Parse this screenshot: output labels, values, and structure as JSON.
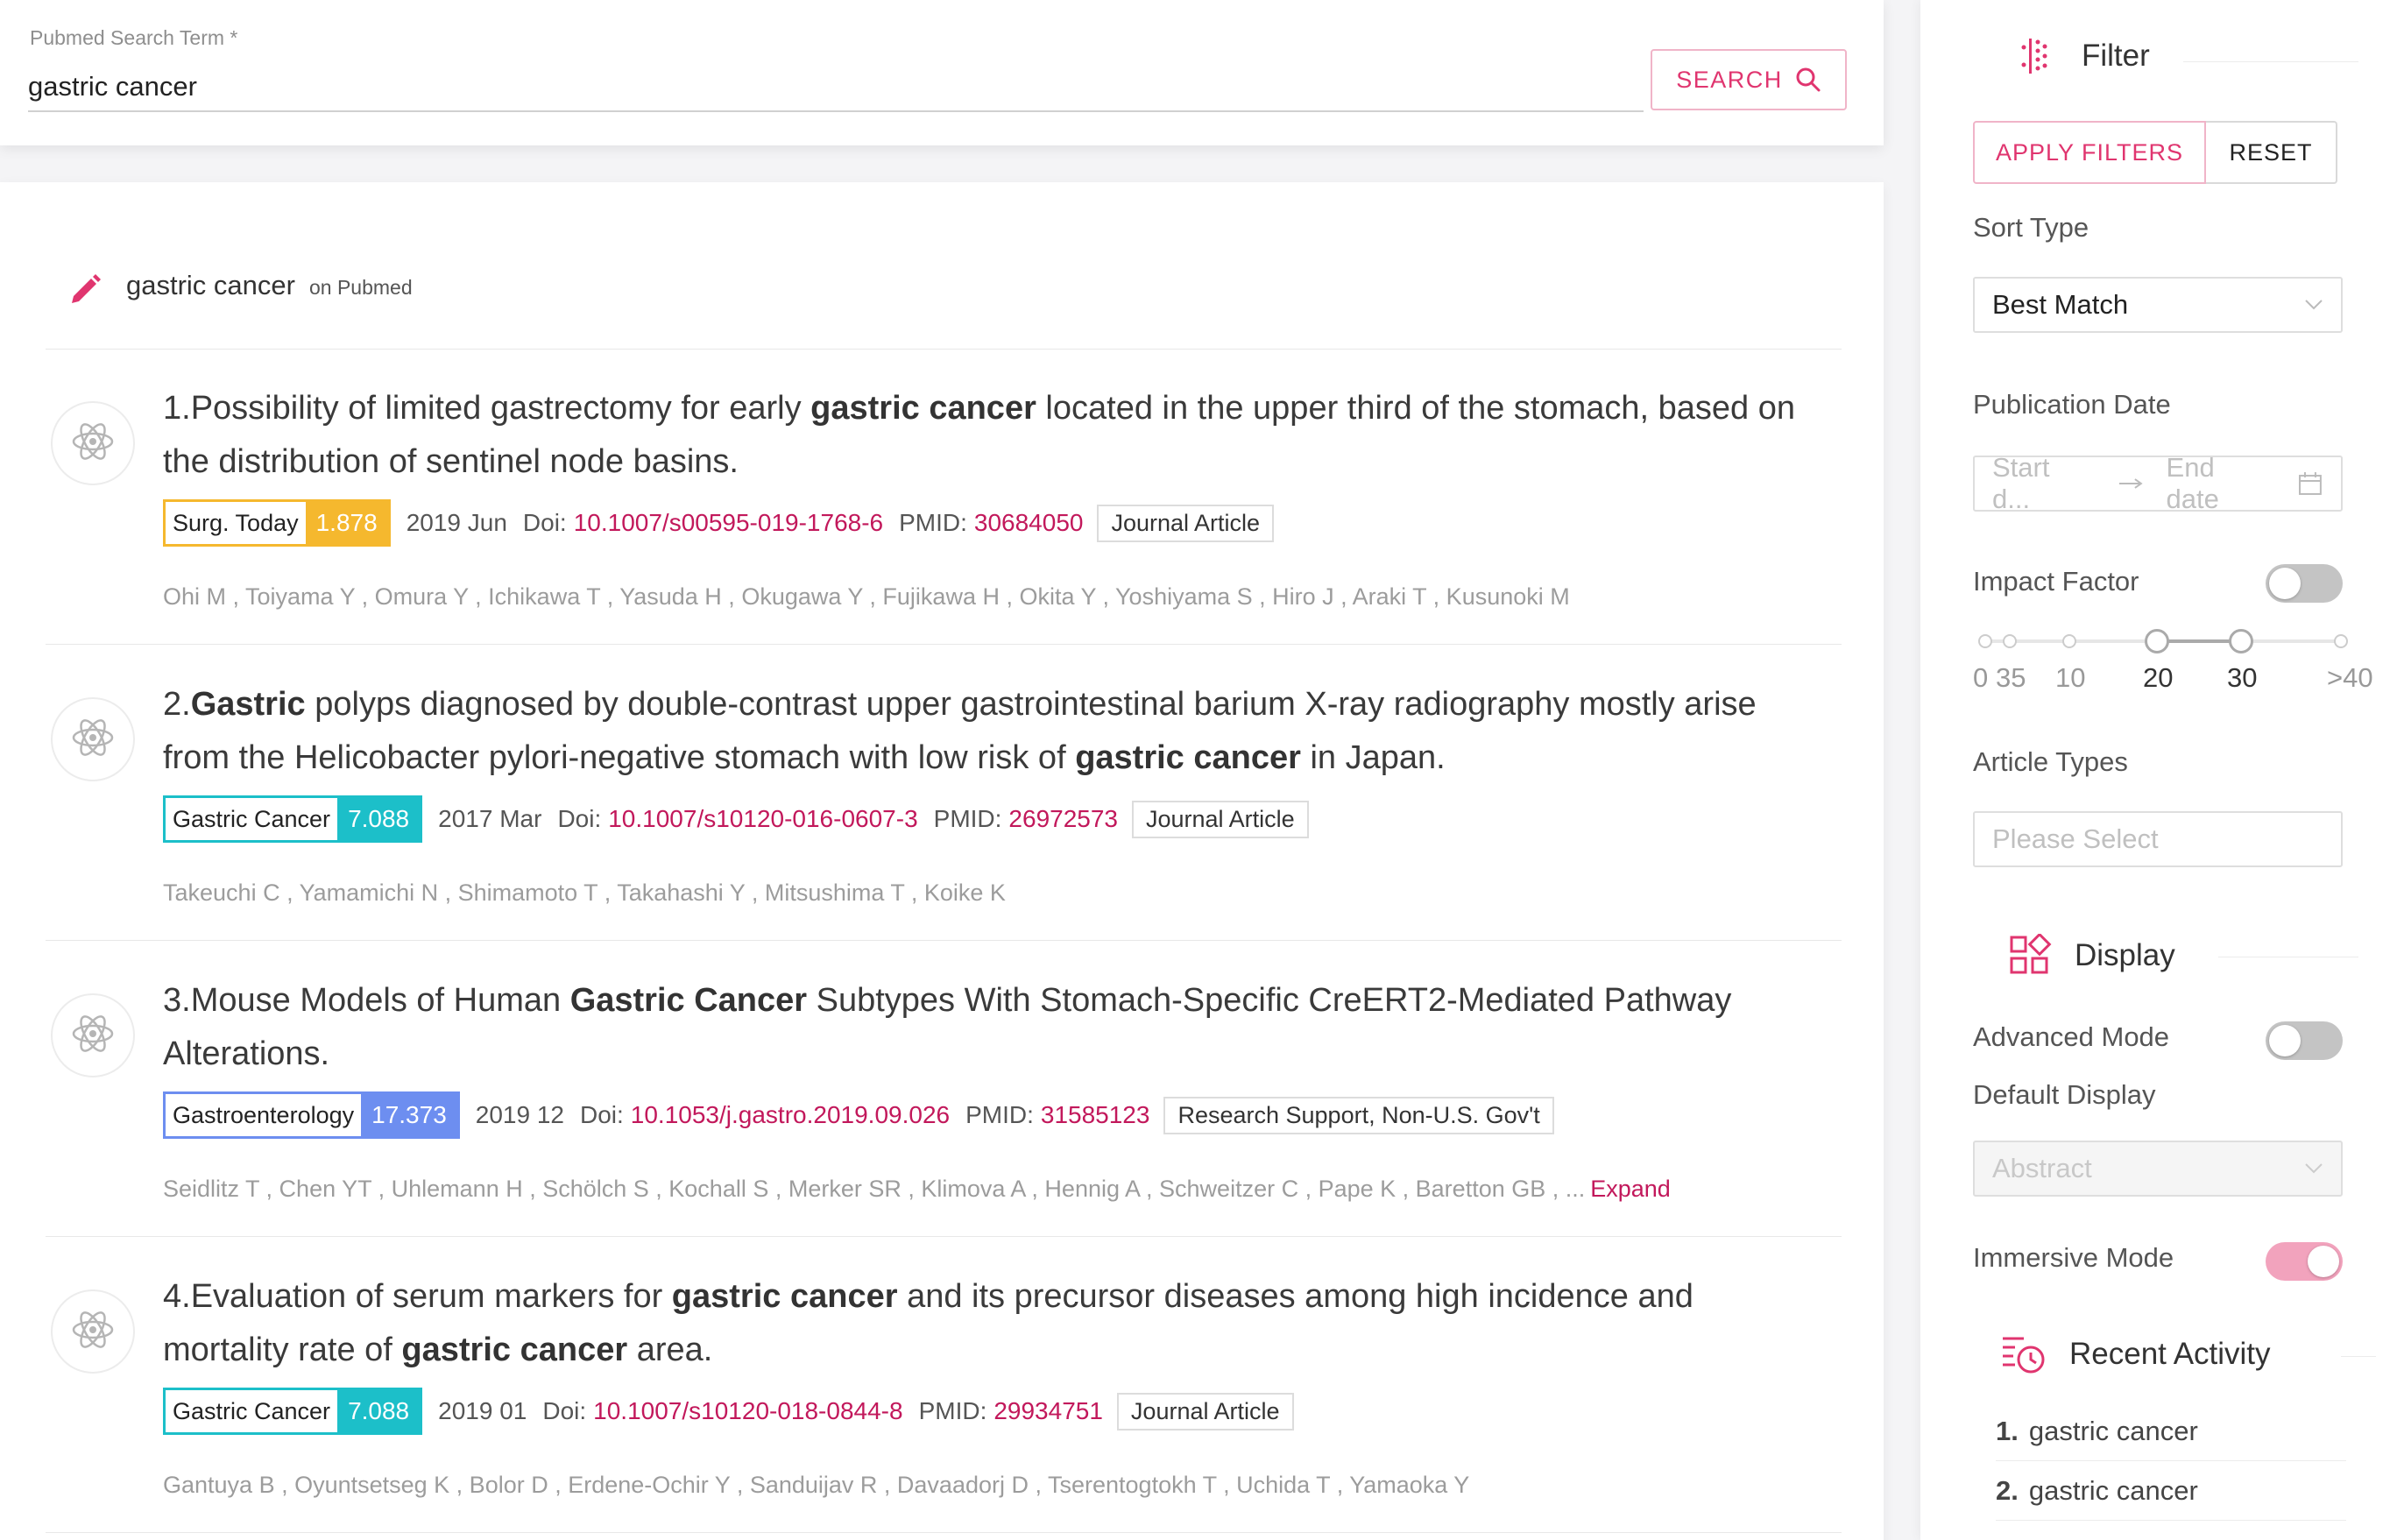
{
  "search": {
    "label": "Pubmed Search Term *",
    "value": "gastric cancer",
    "button_label": "SEARCH"
  },
  "results": {
    "query": "gastric cancer",
    "source": "on Pubmed",
    "articles": [
      {
        "num": "1.",
        "title_parts": [
          {
            "text": "Possibility of limited gastrectomy for early ",
            "bold": false
          },
          {
            "text": "gastric cancer",
            "bold": true
          },
          {
            "text": " located in the upper third of the stomach, based on the distribution of sentinel node basins.",
            "bold": false
          }
        ],
        "journal": "Surg. Today",
        "impact": "1.878",
        "color": "#f5b82e",
        "date": "2019 Jun",
        "doi_label": "Doi:",
        "doi": "10.1007/s00595-019-1768-6",
        "pmid_label": "PMID:",
        "pmid": "30684050",
        "type": "Journal Article",
        "authors": "Ohi M , Toiyama Y , Omura Y , Ichikawa T , Yasuda H , Okugawa Y , Fujikawa H , Okita Y , Yoshiyama S , Hiro J , Araki T , Kusunoki M",
        "expand": ""
      },
      {
        "num": "2.",
        "title_parts": [
          {
            "text": "Gastric",
            "bold": true
          },
          {
            "text": " polyps diagnosed by double-contrast upper gastrointestinal barium X-ray radiography mostly arise from the Helicobacter pylori-negative stomach with low risk of ",
            "bold": false
          },
          {
            "text": "gastric cancer",
            "bold": true
          },
          {
            "text": " in Japan.",
            "bold": false
          }
        ],
        "journal": "Gastric Cancer",
        "impact": "7.088",
        "color": "#1cbfc9",
        "date": "2017 Mar",
        "doi_label": "Doi:",
        "doi": "10.1007/s10120-016-0607-3",
        "pmid_label": "PMID:",
        "pmid": "26972573",
        "type": "Journal Article",
        "authors": "Takeuchi C , Yamamichi N , Shimamoto T , Takahashi Y , Mitsushima T , Koike K",
        "expand": ""
      },
      {
        "num": "3.",
        "title_parts": [
          {
            "text": "Mouse Models of Human ",
            "bold": false
          },
          {
            "text": "Gastric Cancer",
            "bold": true
          },
          {
            "text": " Subtypes With Stomach-Specific CreERT2-Mediated Pathway Alterations.",
            "bold": false
          }
        ],
        "journal": "Gastroenterology",
        "impact": "17.373",
        "color": "#6d8ef0",
        "date": "2019 12",
        "doi_label": "Doi:",
        "doi": "10.1053/j.gastro.2019.09.026",
        "pmid_label": "PMID:",
        "pmid": "31585123",
        "type": "Research Support, Non-U.S. Gov't",
        "authors": "Seidlitz T , Chen YT , Uhlemann H , Schölch S , Kochall S , Merker SR , Klimova A , Hennig A , Schweitzer C , Pape K , Baretton GB , ...",
        "expand": "Expand"
      },
      {
        "num": "4.",
        "title_parts": [
          {
            "text": "Evaluation of serum markers for ",
            "bold": false
          },
          {
            "text": "gastric cancer",
            "bold": true
          },
          {
            "text": " and its precursor diseases among high incidence and mortality rate of ",
            "bold": false
          },
          {
            "text": "gastric cancer",
            "bold": true
          },
          {
            "text": " area.",
            "bold": false
          }
        ],
        "journal": "Gastric Cancer",
        "impact": "7.088",
        "color": "#1cbfc9",
        "date": "2019 01",
        "doi_label": "Doi:",
        "doi": "10.1007/s10120-018-0844-8",
        "pmid_label": "PMID:",
        "pmid": "29934751",
        "type": "Journal Article",
        "authors": "Gantuya B , Oyuntsetseg K , Bolor D , Erdene-Ochir Y , Sanduijav R , Davaadorj D , Tserentogtokh T , Uchida T , Yamaoka Y",
        "expand": ""
      }
    ]
  },
  "sidebar": {
    "filter": {
      "title": "Filter",
      "apply_label": "APPLY FILTERS",
      "reset_label": "RESET",
      "sort_label": "Sort Type",
      "sort_value": "Best Match",
      "pubdate_label": "Publication Date",
      "start_placeholder": "Start d...",
      "end_placeholder": "End date",
      "impact_label": "Impact Factor",
      "impact_enabled": false,
      "impact_marks": [
        "0",
        "35",
        "10",
        "20",
        "30",
        ">40"
      ],
      "impact_range": [
        20,
        30
      ],
      "article_types_label": "Article Types",
      "article_types_placeholder": "Please Select"
    },
    "display": {
      "title": "Display",
      "advanced_label": "Advanced Mode",
      "advanced_enabled": false,
      "default_label": "Default Display",
      "default_value": "Abstract",
      "immersive_label": "Immersive Mode",
      "immersive_enabled": true
    },
    "recent": {
      "title": "Recent Activity",
      "items": [
        {
          "num": "1.",
          "text": "gastric cancer"
        },
        {
          "num": "2.",
          "text": "gastric cancer"
        }
      ]
    }
  },
  "colors": {
    "accent": "#e0356f",
    "link": "#c2185b"
  }
}
